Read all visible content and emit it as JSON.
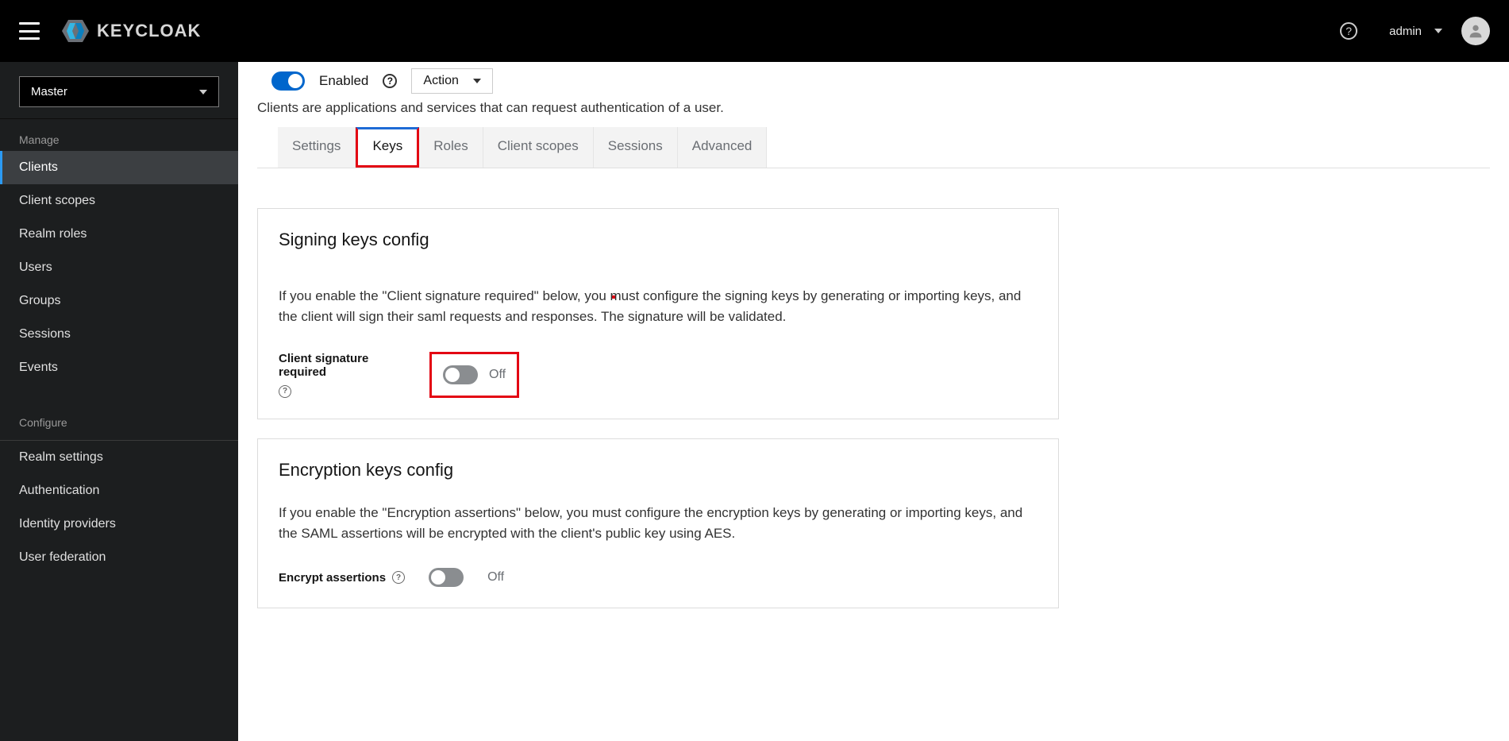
{
  "brand": "KEYCLOAK",
  "header": {
    "user": "admin"
  },
  "sidebar": {
    "realm": "Master",
    "manage_label": "Manage",
    "configure_label": "Configure",
    "items_manage": [
      {
        "label": "Clients",
        "active": true
      },
      {
        "label": "Client scopes"
      },
      {
        "label": "Realm roles"
      },
      {
        "label": "Users"
      },
      {
        "label": "Groups"
      },
      {
        "label": "Sessions"
      },
      {
        "label": "Events"
      }
    ],
    "items_configure": [
      {
        "label": "Realm settings"
      },
      {
        "label": "Authentication"
      },
      {
        "label": "Identity providers"
      },
      {
        "label": "User federation"
      }
    ]
  },
  "client": {
    "enabled_label": "Enabled",
    "action_label": "Action",
    "description": "Clients are applications and services that can request authentication of a user."
  },
  "tabs": [
    {
      "label": "Settings"
    },
    {
      "label": "Keys",
      "active": true
    },
    {
      "label": "Roles"
    },
    {
      "label": "Client scopes"
    },
    {
      "label": "Sessions"
    },
    {
      "label": "Advanced"
    }
  ],
  "signing": {
    "title": "Signing keys config",
    "desc": "If you enable the \"Client signature required\" below, you must configure the signing keys by generating or importing keys, and the client will sign their saml requests and responses. The signature will be validated.",
    "field_label": "Client signature required",
    "state_label": "Off"
  },
  "encryption": {
    "title": "Encryption keys config",
    "desc": "If you enable the \"Encryption assertions\" below, you must configure the encryption keys by generating or importing keys, and the SAML assertions will be encrypted with the client's public key using AES.",
    "field_label": "Encrypt assertions",
    "state_label": "Off"
  }
}
